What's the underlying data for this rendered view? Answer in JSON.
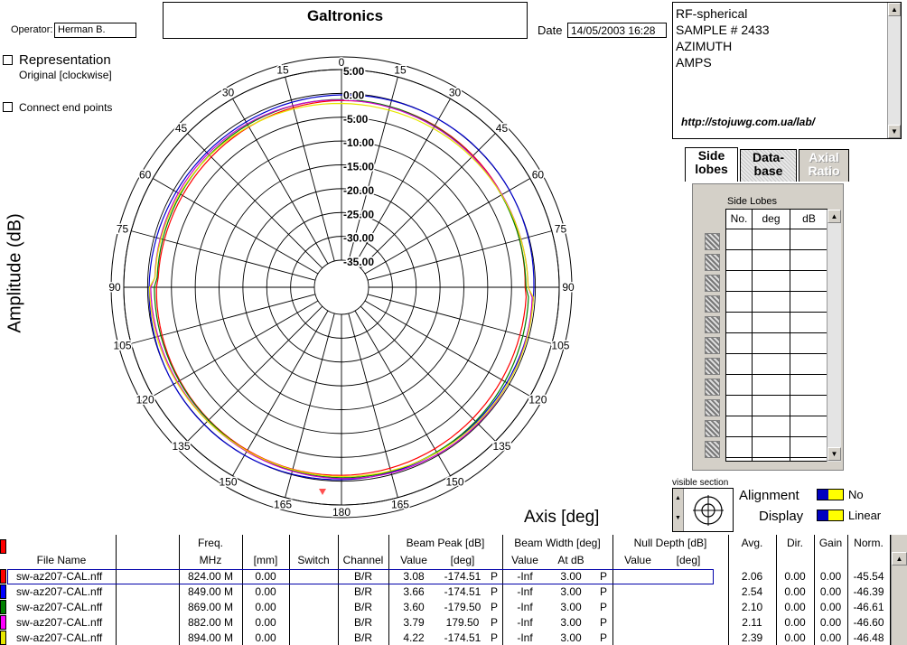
{
  "header": {
    "operator_label": "Operator:",
    "operator_value": "Herman B.",
    "title": "Galtronics",
    "date_label": "Date",
    "date_value": "14/05/2003 16:28"
  },
  "notes": {
    "lines": [
      "RF-spherical",
      "SAMPLE # 2433",
      "AZIMUTH",
      "AMPS"
    ],
    "url": "http://stojuwg.com.ua/lab/"
  },
  "options": {
    "representation_label": "Representation",
    "representation_sub": "Original [clockwise]",
    "connect_label": "Connect end points"
  },
  "plot": {
    "y_title": "Amplitude (dB)",
    "axis_title": "Axis  [deg]",
    "angle_labels": [
      "0",
      "15",
      "30",
      "45",
      "60",
      "75",
      "90",
      "105",
      "120",
      "135",
      "150",
      "165",
      "180",
      "165",
      "150",
      "135",
      "120",
      "105",
      "90",
      "75",
      "60",
      "45",
      "30",
      "15"
    ],
    "ring_labels": [
      "5.00",
      "0.00",
      "-5.00",
      "-10.00",
      "-15.00",
      "-20.00",
      "-25.00",
      "-30.00",
      "-35.00"
    ],
    "trace_colors": [
      "#0000cc",
      "#ff0000",
      "#008000",
      "#cc00cc",
      "#e6e600"
    ]
  },
  "tabs": {
    "side_lobes": "Side\nlobes",
    "database": "Data-\nbase",
    "axial_ratio": "Axial\nRatio"
  },
  "sidelobes": {
    "title": "Side Lobes",
    "col_no": "No.",
    "col_deg": "deg",
    "col_db": "dB"
  },
  "controls": {
    "visible_section": "visible section",
    "alignment_label": "Alignment",
    "alignment_value": "No",
    "display_label": "Display",
    "display_value": "Linear"
  },
  "table": {
    "headers": {
      "file_name": "File Name",
      "freq": "Freq.",
      "freq_unit": "MHz",
      "mm": "[mm]",
      "switch": "Switch",
      "channel": "Channel",
      "beam_peak": "Beam Peak [dB]",
      "bp_value": "Value",
      "bp_deg": "[deg]",
      "beam_width": "Beam Width [deg]",
      "bw_value": "Value",
      "bw_at": "At dB",
      "null_depth": "Null Depth [dB]",
      "nd_value": "Value",
      "nd_deg": "[deg]",
      "avg": "Avg.",
      "dir": "Dir.",
      "gain": "Gain",
      "norm": "Norm."
    },
    "rows": [
      {
        "color": "#ff0000",
        "file": "sw-az207-CAL.nff",
        "freq": "824.00 M",
        "mm": "0.00",
        "channel": "B/R",
        "bp_value": "3.08",
        "bp_deg": "-174.51",
        "p1": "P",
        "bw_value": "-Inf",
        "bw_at": "3.00",
        "p2": "P",
        "avg": "2.06",
        "dir": "0.00",
        "gain": "0.00",
        "norm": "-45.54"
      },
      {
        "color": "#0000ff",
        "file": "sw-az207-CAL.nff",
        "freq": "849.00 M",
        "mm": "0.00",
        "channel": "B/R",
        "bp_value": "3.66",
        "bp_deg": "-174.51",
        "p1": "P",
        "bw_value": "-Inf",
        "bw_at": "3.00",
        "p2": "P",
        "avg": "2.54",
        "dir": "0.00",
        "gain": "0.00",
        "norm": "-46.39"
      },
      {
        "color": "#008000",
        "file": "sw-az207-CAL.nff",
        "freq": "869.00 M",
        "mm": "0.00",
        "channel": "B/R",
        "bp_value": "3.60",
        "bp_deg": "-179.50",
        "p1": "P",
        "bw_value": "-Inf",
        "bw_at": "3.00",
        "p2": "P",
        "avg": "2.10",
        "dir": "0.00",
        "gain": "0.00",
        "norm": "-46.61"
      },
      {
        "color": "#ff00ff",
        "file": "sw-az207-CAL.nff",
        "freq": "882.00 M",
        "mm": "0.00",
        "channel": "B/R",
        "bp_value": "3.79",
        "bp_deg": "179.50",
        "p1": "P",
        "bw_value": "-Inf",
        "bw_at": "3.00",
        "p2": "P",
        "avg": "2.11",
        "dir": "0.00",
        "gain": "0.00",
        "norm": "-46.60"
      },
      {
        "color": "#e6e600",
        "file": "sw-az207-CAL.nff",
        "freq": "894.00 M",
        "mm": "0.00",
        "channel": "B/R",
        "bp_value": "4.22",
        "bp_deg": "-174.51",
        "p1": "P",
        "bw_value": "-Inf",
        "bw_at": "3.00",
        "p2": "P",
        "avg": "2.39",
        "dir": "0.00",
        "gain": "0.00",
        "norm": "-46.48"
      }
    ]
  }
}
